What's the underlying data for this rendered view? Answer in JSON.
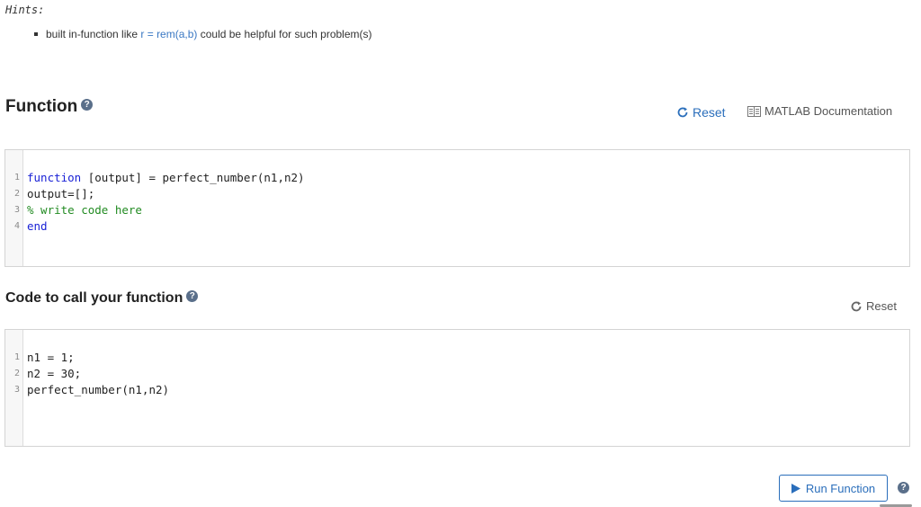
{
  "hints": {
    "title": "Hints:",
    "item_prefix": "built in-function like ",
    "item_code": "r = rem(a,b)",
    "item_suffix": " could be helpful for such problem(s)"
  },
  "function_section": {
    "title": "Function",
    "help_glyph": "?",
    "reset_label": "Reset",
    "docs_label": "MATLAB Documentation",
    "code": [
      {
        "n": "1",
        "kw": "function",
        "rest": " [output] = perfect_number(n1,n2)"
      },
      {
        "n": "2",
        "text": "output=[];"
      },
      {
        "n": "3",
        "comment": "% write code here"
      },
      {
        "n": "4",
        "kw": "end"
      }
    ]
  },
  "call_section": {
    "title": "Code to call your function",
    "help_glyph": "?",
    "reset_label": "Reset",
    "code": [
      {
        "n": "1",
        "text": "n1 = 1;"
      },
      {
        "n": "2",
        "text": "n2 = 30;"
      },
      {
        "n": "3",
        "text": "perfect_number(n1,n2)"
      }
    ]
  },
  "run": {
    "label": "Run Function",
    "help_glyph": "?"
  },
  "icons": {
    "reset": "refresh-icon",
    "docs": "documentation-icon",
    "run": "play-icon",
    "help": "question-icon"
  },
  "colors": {
    "accent": "#2a6ebb",
    "keyword": "#1a22d6",
    "comment": "#228b22"
  }
}
